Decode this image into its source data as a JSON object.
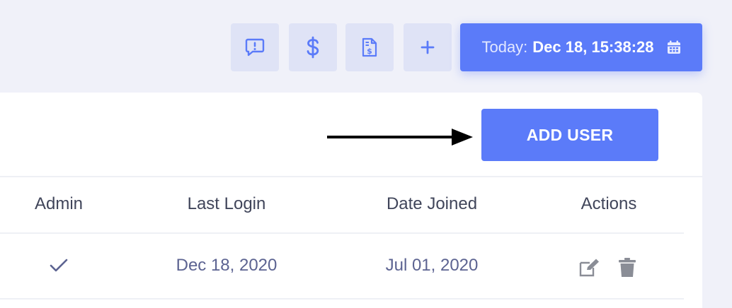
{
  "toolbar": {
    "icons": [
      "feedback-icon",
      "dollar-icon",
      "invoice-icon",
      "plus-icon"
    ],
    "today": {
      "label": "Today:",
      "value": "Dec 18, 15:38:28",
      "icon": "calendar-icon"
    }
  },
  "card": {
    "add_user_label": "ADD USER"
  },
  "table": {
    "headers": {
      "admin": "Admin",
      "last_login": "Last Login",
      "date_joined": "Date Joined",
      "actions": "Actions"
    },
    "rows": [
      {
        "admin_icon": "check-icon",
        "last_login": "Dec 18, 2020",
        "date_joined": "Jul 01, 2020",
        "action_icons": [
          "edit-icon",
          "trash-icon"
        ]
      }
    ]
  },
  "colors": {
    "accent": "#5b7bf9",
    "tool_button_bg": "#dfe3f6",
    "text_dark": "#40455a",
    "text_muted": "#5c6391",
    "icon_gray": "#8a8d96"
  }
}
